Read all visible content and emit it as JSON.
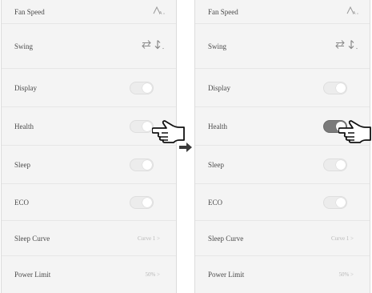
{
  "left_panel": {
    "fan_speed": {
      "label": "Fan Speed"
    },
    "swing": {
      "label": "Swing"
    },
    "display": {
      "label": "Display",
      "on": false
    },
    "health": {
      "label": "Health",
      "on": false
    },
    "sleep": {
      "label": "Sleep",
      "on": false
    },
    "eco": {
      "label": "ECO",
      "on": false
    },
    "sleep_curve": {
      "label": "Sleep Curve",
      "value": "Curve 1 >"
    },
    "power_limit": {
      "label": "Power Limit",
      "value": "50% >"
    }
  },
  "right_panel": {
    "fan_speed": {
      "label": "Fan Speed"
    },
    "swing": {
      "label": "Swing"
    },
    "display": {
      "label": "Display",
      "on": false
    },
    "health": {
      "label": "Health",
      "on": true
    },
    "sleep": {
      "label": "Sleep",
      "on": false
    },
    "eco": {
      "label": "ECO",
      "on": false
    },
    "sleep_curve": {
      "label": "Sleep Curve",
      "value": "Curve 1 >"
    },
    "power_limit": {
      "label": "Power Limit",
      "value": "50% >"
    }
  },
  "icons": {
    "fan": "fan-auto-icon",
    "swing": "swing-arrows-icon",
    "pointer": "pointing-hand-icon",
    "transition": "right-arrow-icon"
  },
  "colors": {
    "panel_bg": "#f4f4f4",
    "toggle_off": "#ececec",
    "toggle_on": "#7a7a7a"
  }
}
